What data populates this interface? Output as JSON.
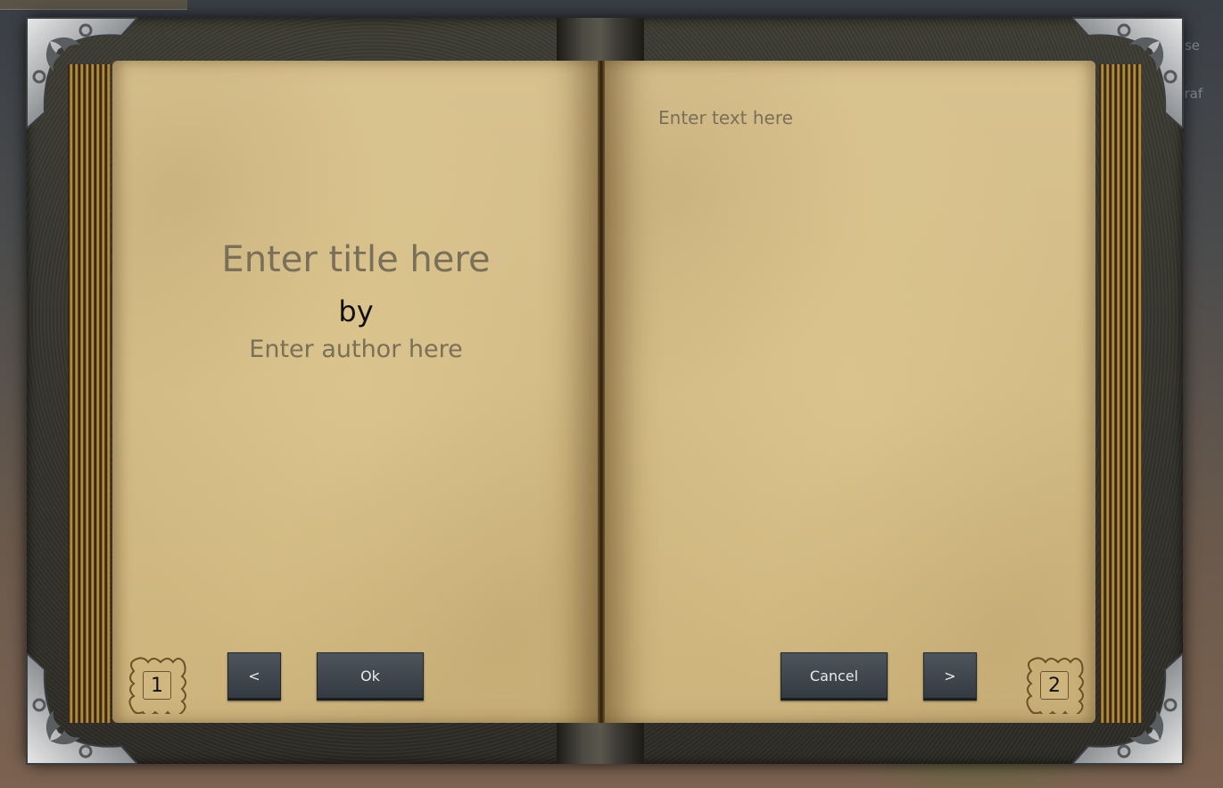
{
  "background_hud": {
    "items": [
      "Use",
      "Craf"
    ]
  },
  "book": {
    "left_page": {
      "title_placeholder": "Enter title here",
      "by_label": "by",
      "author_placeholder": "Enter author here",
      "page_number": "1"
    },
    "right_page": {
      "text_placeholder": "Enter text here",
      "page_number": "2"
    },
    "buttons": {
      "prev_label": "<",
      "ok_label": "Ok",
      "cancel_label": "Cancel",
      "next_label": ">"
    }
  },
  "colors": {
    "page": "#d8c28f",
    "cover": "#3d3c33",
    "button": "#3f464e",
    "placeholder_text": "#7a6f58"
  }
}
